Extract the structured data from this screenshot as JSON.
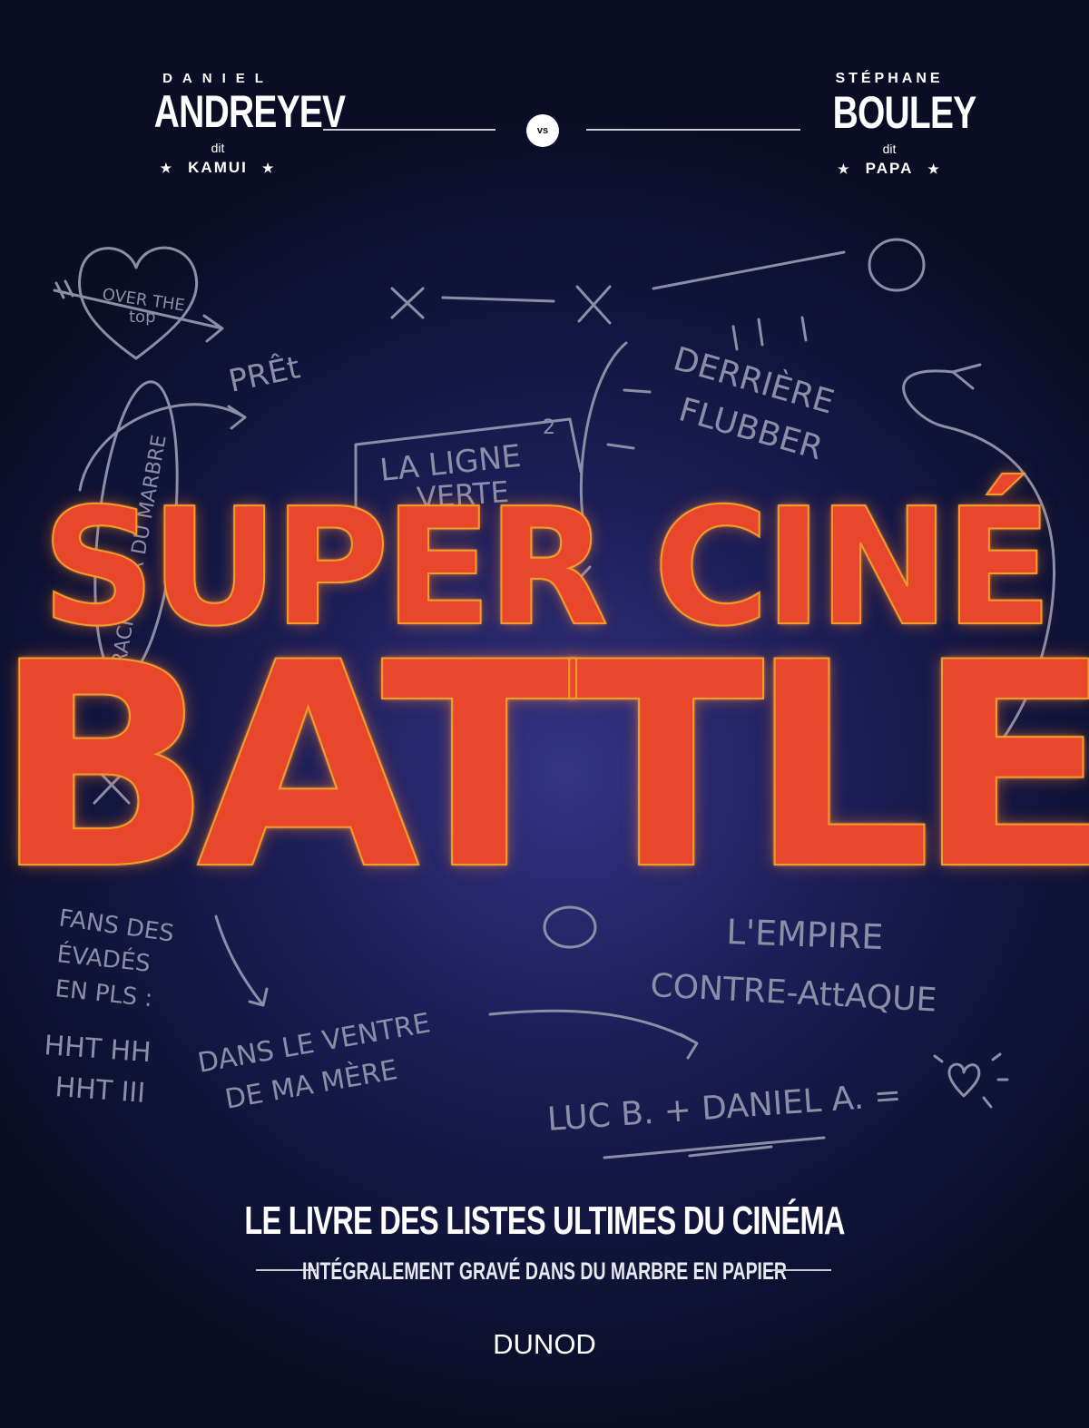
{
  "authors": {
    "left": {
      "first_name": "DANIEL",
      "last_name": "ANDREYEV",
      "dit": "dit",
      "nickname": "KAMUI"
    },
    "right": {
      "first_name": "STÉPHANE",
      "last_name": "BOULEY",
      "dit": "dit",
      "nickname": "PAPA"
    },
    "versus": "vs"
  },
  "title": {
    "line1": "SUPER CINÉ",
    "line2": "BATTLE"
  },
  "doodles": {
    "over_the": "OVER THE",
    "top": "top",
    "pret": "PRÊt",
    "racheter": "RACHETER DU MARBRE",
    "la_ligne": "LA LIGNE",
    "exponent": "2",
    "verte": "VERTE",
    "derriere": "DERRIÈRE",
    "flubber": "FLUBBER",
    "fans_des": "FANS DES",
    "evades": "ÉVADÉS",
    "en_pls": "EN PLS :",
    "tally1": "HHT HH",
    "tally2": "HHT III",
    "empire": "L'EMPIRE",
    "contre": "CONTRE-AttAQUE",
    "dans_le_ventre": "DANS LE VENTRE",
    "de_ma_mere": "DE MA MÈRE",
    "luc_daniel": "LUC B. + DANIEL A. =",
    "heart_icon": "heart-icon"
  },
  "subtitle": "LE LIVRE DES LISTES ULTIMES DU CINÉMA",
  "tagline": "INTÉGRALEMENT GRAVÉ DANS DU MARBRE EN PAPIER",
  "publisher": "DUNOD",
  "colors": {
    "background": "#0c0f2a",
    "title_red": "#e5372a",
    "title_orange": "#f5a23a",
    "doodle_gray": "#8b8ea6",
    "text_white": "#ffffff"
  }
}
